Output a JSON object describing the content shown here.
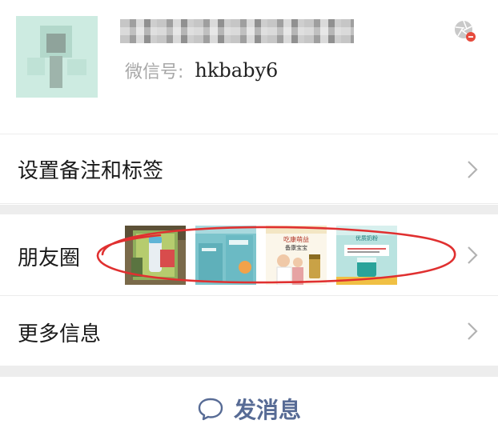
{
  "profile": {
    "wechat_id_label": "微信号:",
    "wechat_id_value": "hkbaby6",
    "avatar_colors": [
      "#cdebe1",
      "#b9ddd0",
      "#98a5a0"
    ]
  },
  "menu": {
    "remark_tags_label": "设置备注和标签",
    "moments_label": "朋友圈",
    "more_info_label": "更多信息"
  },
  "moments_thumbnails": [
    {
      "name": "baby-bottle-photo"
    },
    {
      "name": "teal-product-box-photo"
    },
    {
      "name": "family-supplement-ad"
    },
    {
      "name": "teal-product-promo"
    }
  ],
  "moments_thumbnail_texts": {
    "thumb3_headline": "吃康萌益",
    "thumb3_sub": "备康宝宝",
    "thumb4_headline": "优质奶粉"
  },
  "actions": {
    "send_message_label": "发消息"
  },
  "colors": {
    "link_blue": "#576b95",
    "separator_gray": "#ededed",
    "annotation_red": "#e03030",
    "chevron_gray": "#b2b2b2"
  }
}
